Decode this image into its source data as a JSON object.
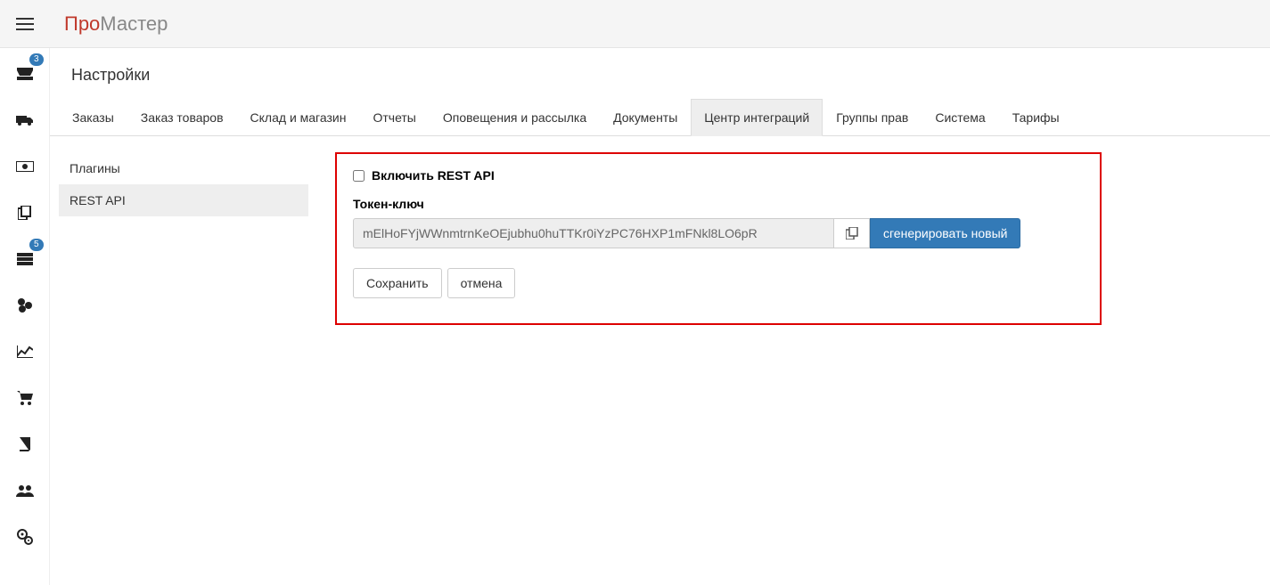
{
  "brand": {
    "part1": "Про",
    "part2": "Мастер"
  },
  "sidebar_icons": [
    {
      "name": "inbox-icon",
      "badge": "3"
    },
    {
      "name": "truck-icon"
    },
    {
      "name": "money-icon"
    },
    {
      "name": "copy-icon"
    },
    {
      "name": "layers-icon",
      "badge": "5"
    },
    {
      "name": "globe-icon"
    },
    {
      "name": "chart-line-icon"
    },
    {
      "name": "cart-icon"
    },
    {
      "name": "book-icon"
    },
    {
      "name": "users-icon"
    },
    {
      "name": "cogs-icon"
    }
  ],
  "page_title": "Настройки",
  "tabs": [
    {
      "label": "Заказы"
    },
    {
      "label": "Заказ товаров"
    },
    {
      "label": "Склад и магазин"
    },
    {
      "label": "Отчеты"
    },
    {
      "label": "Оповещения и рассылка"
    },
    {
      "label": "Документы"
    },
    {
      "label": "Центр интеграций",
      "active": true
    },
    {
      "label": "Группы прав"
    },
    {
      "label": "Система"
    },
    {
      "label": "Тарифы"
    }
  ],
  "left_nav": [
    {
      "label": "Плагины"
    },
    {
      "label": "REST API",
      "active": true
    }
  ],
  "panel": {
    "enable_label": "Включить REST API",
    "token_label": "Токен-ключ",
    "token_value": "mElHoFYjWWnmtrnKeOEjubhu0huTTKr0iYzPC76HXP1mFNkl8LO6pR",
    "generate_label": "сгенерировать новый",
    "save_label": "Сохранить",
    "cancel_label": "отмена"
  }
}
